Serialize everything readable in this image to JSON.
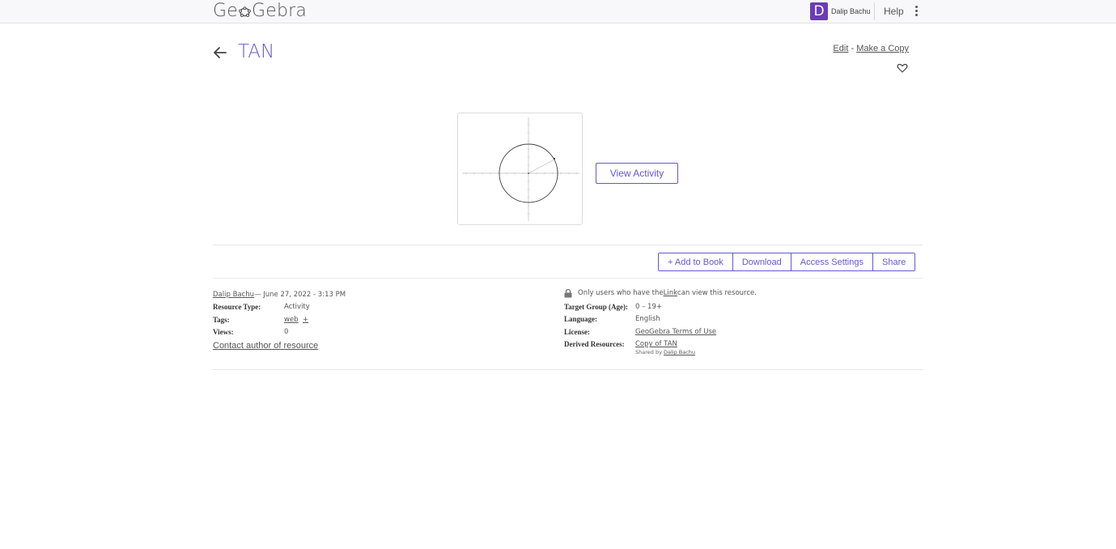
{
  "header": {
    "logo_pre": "Ge",
    "logo_post": "Gebra",
    "user_initial": "D",
    "user_name": "Dalip Bachu",
    "help": "Help"
  },
  "page": {
    "title": "TAN",
    "edit": "Edit",
    "sep": "-",
    "copy": "Make a Copy"
  },
  "preview": {
    "view_button": "View Activity"
  },
  "actions": {
    "add_to_book": "+ Add to Book",
    "download": "Download",
    "access_settings": "Access Settings",
    "share": "Share"
  },
  "meta": {
    "author": "Dalip Bachu",
    "date": " — June 27, 2022 - 3:13 PM",
    "resource_type_label": "Resource Type:",
    "resource_type": "Activity",
    "tags_label": "Tags:",
    "tag": "web",
    "tag_add": "+",
    "views_label": "Views:",
    "views": "0",
    "contact": "Contact author of resource"
  },
  "meta_right": {
    "access_pre": "Only users who have the ",
    "access_link": "Link",
    "access_post": " can view this resource.",
    "target_label": "Target Group (Age):",
    "target": "0 – 19+",
    "language_label": "Language:",
    "language": "English",
    "license_label": "License:",
    "license": "GeoGebra Terms of Use",
    "derived_label": "Derived Resources:",
    "derived": "Copy of TAN",
    "shared_pre": "Shared by ",
    "shared_by": "Dalip Bachu"
  },
  "colors": {
    "accent": "#6557d2",
    "avatar": "#6a3cb8"
  }
}
